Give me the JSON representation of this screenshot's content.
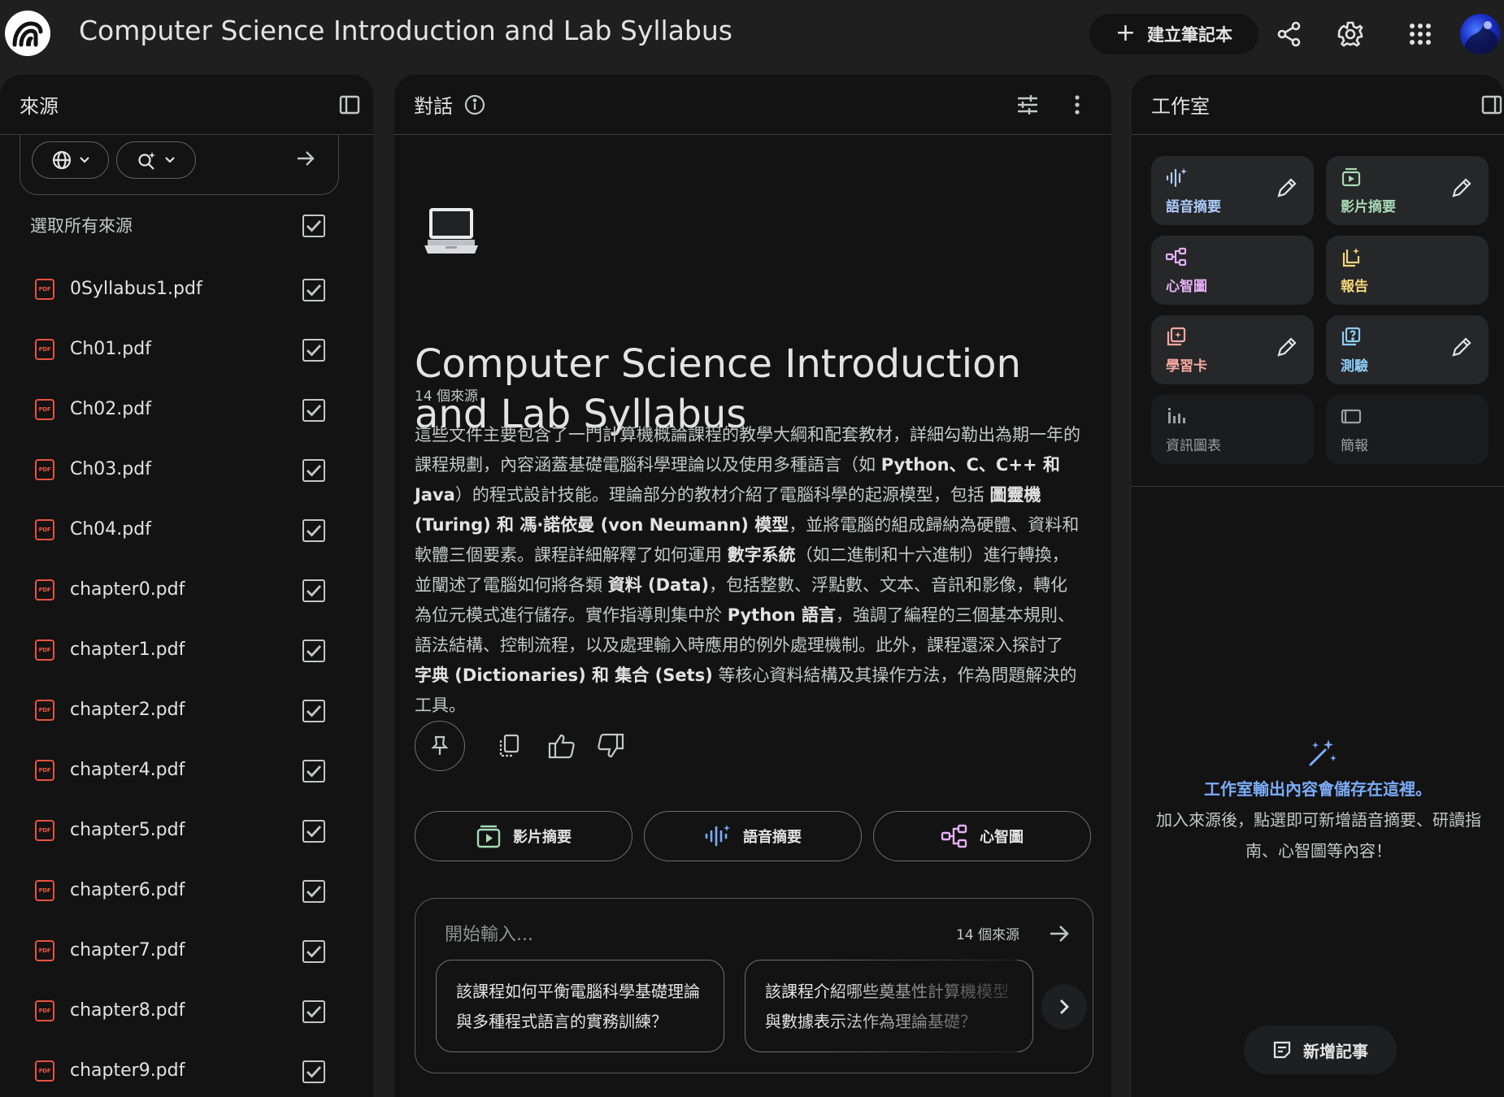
{
  "header": {
    "title": "Computer Science Introduction and Lab Syllabus",
    "create_label": "建立筆記本",
    "icons": [
      "notebooklm-logo-icon",
      "share-icon",
      "settings-gear-icon",
      "apps-grid-icon",
      "avatar"
    ]
  },
  "sources": {
    "title": "來源",
    "select_all_label": "選取所有來源",
    "items": [
      {
        "name": "0Syllabus1.pdf",
        "checked": true
      },
      {
        "name": "Ch01.pdf",
        "checked": true
      },
      {
        "name": "Ch02.pdf",
        "checked": true
      },
      {
        "name": "Ch03.pdf",
        "checked": true
      },
      {
        "name": "Ch04.pdf",
        "checked": true
      },
      {
        "name": "chapter0.pdf",
        "checked": true
      },
      {
        "name": "chapter1.pdf",
        "checked": true
      },
      {
        "name": "chapter2.pdf",
        "checked": true
      },
      {
        "name": "chapter4.pdf",
        "checked": true
      },
      {
        "name": "chapter5.pdf",
        "checked": true
      },
      {
        "name": "chapter6.pdf",
        "checked": true
      },
      {
        "name": "chapter7.pdf",
        "checked": true
      },
      {
        "name": "chapter8.pdf",
        "checked": true
      },
      {
        "name": "chapter9.pdf",
        "checked": true
      }
    ],
    "pdf_badge": "PDF"
  },
  "chat": {
    "title": "對話",
    "notebook_title": "Computer Science Introduction and Lab Syllabus",
    "source_count": "14 個來源",
    "summary": [
      {
        "t": "這些文件主要包含了一門計算機概論課程的教學大綱和配套教材，詳細勾勒出為期一年的課程規劃，內容涵蓋基礎電腦科學理論以及使用多種語言（如 ",
        "b": false
      },
      {
        "t": "Python、C、C++ 和 Java",
        "b": true
      },
      {
        "t": "）的程式設計技能。理論部分的教材介紹了電腦科學的起源模型，包括 ",
        "b": false
      },
      {
        "t": "圖靈機 (Turing) 和 馮·諾依曼 (von Neumann) 模型",
        "b": true
      },
      {
        "t": "，並將電腦的組成歸納為硬體、資料和軟體三個要素。課程詳細解釋了如何運用 ",
        "b": false
      },
      {
        "t": "數字系統",
        "b": true
      },
      {
        "t": "（如二進制和十六進制）進行轉換，並闡述了電腦如何將各類 ",
        "b": false
      },
      {
        "t": "資料 (Data)",
        "b": true
      },
      {
        "t": "，包括整數、浮點數、文本、音訊和影像，轉化為位元模式進行儲存。實作指導則集中於 ",
        "b": false
      },
      {
        "t": "Python 語言",
        "b": true
      },
      {
        "t": "，強調了編程的三個基本規則、語法結構、控制流程，以及處理輸入時應用的例外處理機制。此外，課程還深入探討了 ",
        "b": false
      },
      {
        "t": "字典 (Dictionaries) 和 集合 (Sets)",
        "b": true
      },
      {
        "t": " 等核心資料結構及其操作方法，作為問題解決的工具。",
        "b": false
      }
    ],
    "actions": {
      "video": "影片摘要",
      "audio": "語音摘要",
      "mindmap": "心智圖"
    },
    "input_placeholder": "開始輸入...",
    "input_source_count": "14 個來源",
    "suggestions": [
      "該課程如何平衡電腦科學基礎理論與多種程式語言的實務訓練？",
      "該課程介紹哪些奠基性計算機模型與數據表示法作為理論基礎？"
    ]
  },
  "studio": {
    "title": "工作室",
    "tiles": [
      {
        "label": "語音摘要",
        "color": "#aecbfa",
        "editable": true
      },
      {
        "label": "影片摘要",
        "color": "#a8dab5",
        "editable": true
      },
      {
        "label": "心智圖",
        "color": "#e4b0f5",
        "editable": false
      },
      {
        "label": "報告",
        "color": "#f5d67b",
        "editable": false
      },
      {
        "label": "學習卡",
        "color": "#f7a8a0",
        "editable": true
      },
      {
        "label": "測驗",
        "color": "#8ecdf8",
        "editable": true
      },
      {
        "label": "資訊圖表",
        "color": "#9aa0a6",
        "editable": false
      },
      {
        "label": "簡報",
        "color": "#9aa0a6",
        "editable": false
      }
    ],
    "empty_title": "工作室輸出內容會儲存在這裡。",
    "empty_text": "加入來源後，點選即可新增語音摘要、研讀指南、心智圖等內容！",
    "add_note_label": "新增記事"
  },
  "colors": {
    "background": "#1f1f1f",
    "panel": "#131314",
    "accent_blue": "#7cacf8",
    "pdf_red": "#e8533f"
  }
}
